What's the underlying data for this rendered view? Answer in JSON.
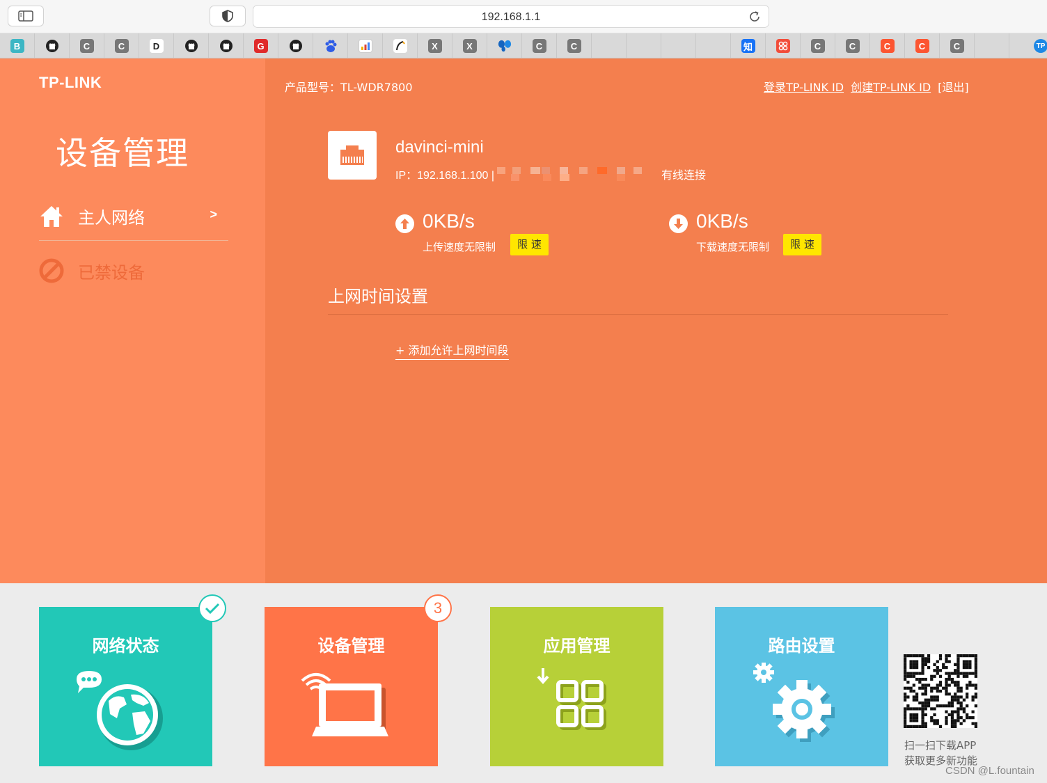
{
  "browser": {
    "url": "192.168.1.1",
    "bookmarks": [
      {
        "icon": "b-icon",
        "glyph": "B",
        "color": "#3cb6c4"
      },
      {
        "icon": "github-icon",
        "glyph": "",
        "color": "#222222"
      },
      {
        "icon": "c-icon",
        "glyph": "C",
        "color": "#777777"
      },
      {
        "icon": "c-icon",
        "glyph": "C",
        "color": "#777777"
      },
      {
        "icon": "d-icon",
        "glyph": "D",
        "color": "#222222"
      },
      {
        "icon": "github-icon",
        "glyph": "",
        "color": "#222222"
      },
      {
        "icon": "github-icon",
        "glyph": "",
        "color": "#222222"
      },
      {
        "icon": "g-icon",
        "glyph": "G",
        "color": "#e02a2a"
      },
      {
        "icon": "github-icon",
        "glyph": "",
        "color": "#222222"
      },
      {
        "icon": "baidu-icon",
        "glyph": "du",
        "color": "#2e5ce6"
      },
      {
        "icon": "stats-icon",
        "glyph": "",
        "color": "#ffffff"
      },
      {
        "icon": "feather-icon",
        "glyph": "",
        "color": "#ffffff"
      },
      {
        "icon": "x-icon",
        "glyph": "X",
        "color": "#777777"
      },
      {
        "icon": "x-icon",
        "glyph": "X",
        "color": "#777777"
      },
      {
        "icon": "butterfly-icon",
        "glyph": "",
        "color": "#1565c0"
      },
      {
        "icon": "c-icon",
        "glyph": "C",
        "color": "#777777"
      },
      {
        "icon": "c-icon",
        "glyph": "C",
        "color": "#777777"
      },
      {
        "icon": "blank-icon",
        "glyph": "",
        "color": "#d9d9d9"
      },
      {
        "icon": "blank-icon",
        "glyph": "",
        "color": "#d9d9d9"
      },
      {
        "icon": "blank-icon",
        "glyph": "",
        "color": "#d9d9d9"
      },
      {
        "icon": "blank-icon",
        "glyph": "",
        "color": "#d9d9d9"
      },
      {
        "icon": "zhihu-icon",
        "glyph": "知",
        "color": "#1772f6"
      },
      {
        "icon": "xiaohongshu-icon",
        "glyph": "",
        "color": "#f24d3a"
      },
      {
        "icon": "c-icon",
        "glyph": "C",
        "color": "#777777"
      },
      {
        "icon": "c-icon",
        "glyph": "C",
        "color": "#777777"
      },
      {
        "icon": "csdn-icon",
        "glyph": "C",
        "color": "#fc5531"
      },
      {
        "icon": "csdn-icon",
        "glyph": "C",
        "color": "#fc5531"
      },
      {
        "icon": "c-icon",
        "glyph": "C",
        "color": "#777777"
      },
      {
        "icon": "blank-icon",
        "glyph": "",
        "color": "#d9d9d9"
      },
      {
        "icon": "tp-icon",
        "glyph": "TP",
        "color": "#1e88e5"
      }
    ]
  },
  "sidebar": {
    "logo": "TP-LINK",
    "title": "设备管理",
    "items": [
      {
        "label": "主人网络",
        "arrow": ">"
      },
      {
        "label": "已禁设备"
      }
    ]
  },
  "header": {
    "model": "产品型号：TL-WDR7800",
    "login_link": "登录TP-LINK ID",
    "create_link": "创建TP-LINK ID",
    "logout": "[退出]"
  },
  "device": {
    "name": "davinci-mini",
    "ip_text": "IP：192.168.1.100 |",
    "connection": "有线连接"
  },
  "upload": {
    "value": "0KB/s",
    "caption": "上传速度无限制",
    "limit_label": "限 速"
  },
  "download": {
    "value": "0KB/s",
    "caption": "下载速度无限制",
    "limit_label": "限 速"
  },
  "time_settings": {
    "title": "上网时间设置",
    "add_link": "+ 添加允许上网时间段"
  },
  "tiles": [
    {
      "label": "网络状态",
      "color": "#22c8b7"
    },
    {
      "label": "设备管理",
      "color": "#ff7448",
      "badge": "3"
    },
    {
      "label": "应用管理",
      "color": "#b7d038"
    },
    {
      "label": "路由设置",
      "color": "#5bc3e4"
    }
  ],
  "app_promo": {
    "line1": "扫一扫下载APP",
    "line2": "获取更多新功能"
  },
  "watermark": "CSDN @L.fountain"
}
